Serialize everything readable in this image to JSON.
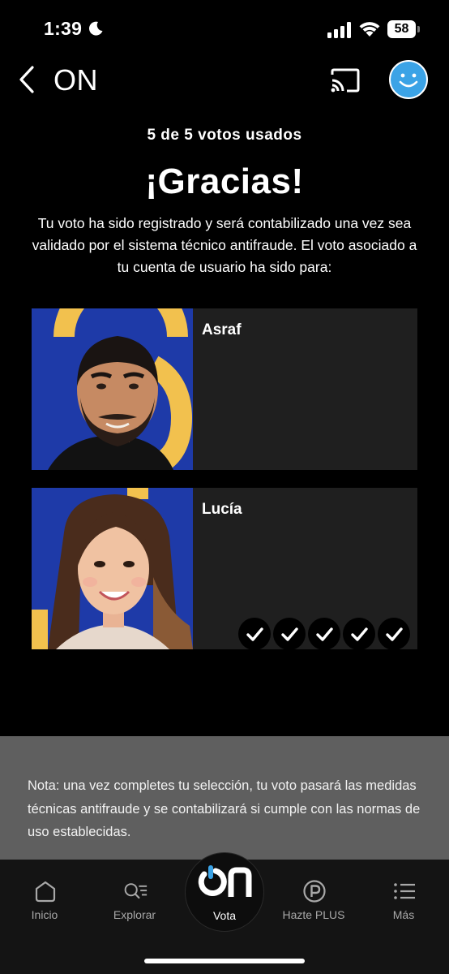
{
  "status_bar": {
    "time": "1:39",
    "battery": "58",
    "icons": [
      "moon-icon",
      "signal-icon",
      "wifi-icon",
      "battery-icon"
    ]
  },
  "header": {
    "title": "ON",
    "icons": [
      "back-icon",
      "cast-icon",
      "avatar-smile-icon"
    ]
  },
  "main": {
    "votes_used": "5 de 5 votos usados",
    "title": "¡Gracias!",
    "message": "Tu voto ha sido registrado y será contabilizado una vez sea validado por el sistema técnico antifraude. El voto asociado a tu cuenta de usuario ha sido para:"
  },
  "candidates": [
    {
      "name": "Asraf",
      "photo": "portrait-man-photo",
      "votes": 0
    },
    {
      "name": "Lucía",
      "photo": "portrait-woman-photo",
      "votes": 5
    }
  ],
  "note": "Nota: una vez completes tu selección, tu voto pasará las medidas técnicas antifraude y se contabilizará si cumple con las normas de uso establecidas.",
  "tab_bar": {
    "items": [
      {
        "label": "Inicio",
        "icon": "home-icon"
      },
      {
        "label": "Explorar",
        "icon": "search-list-icon"
      },
      {
        "label": "Vota",
        "icon": "on-logo-icon",
        "active": true
      },
      {
        "label": "Hazte PLUS",
        "icon": "plus-p-icon"
      },
      {
        "label": "Más",
        "icon": "menu-list-icon"
      }
    ]
  },
  "colors": {
    "background": "#000000",
    "card": "#1f1f1f",
    "note_panel": "#5f5f5f",
    "tab_bar": "#141414",
    "accent_blue": "#3ba3e6",
    "photo_blue": "#1e3aa8",
    "photo_gold": "#f2c14e"
  }
}
